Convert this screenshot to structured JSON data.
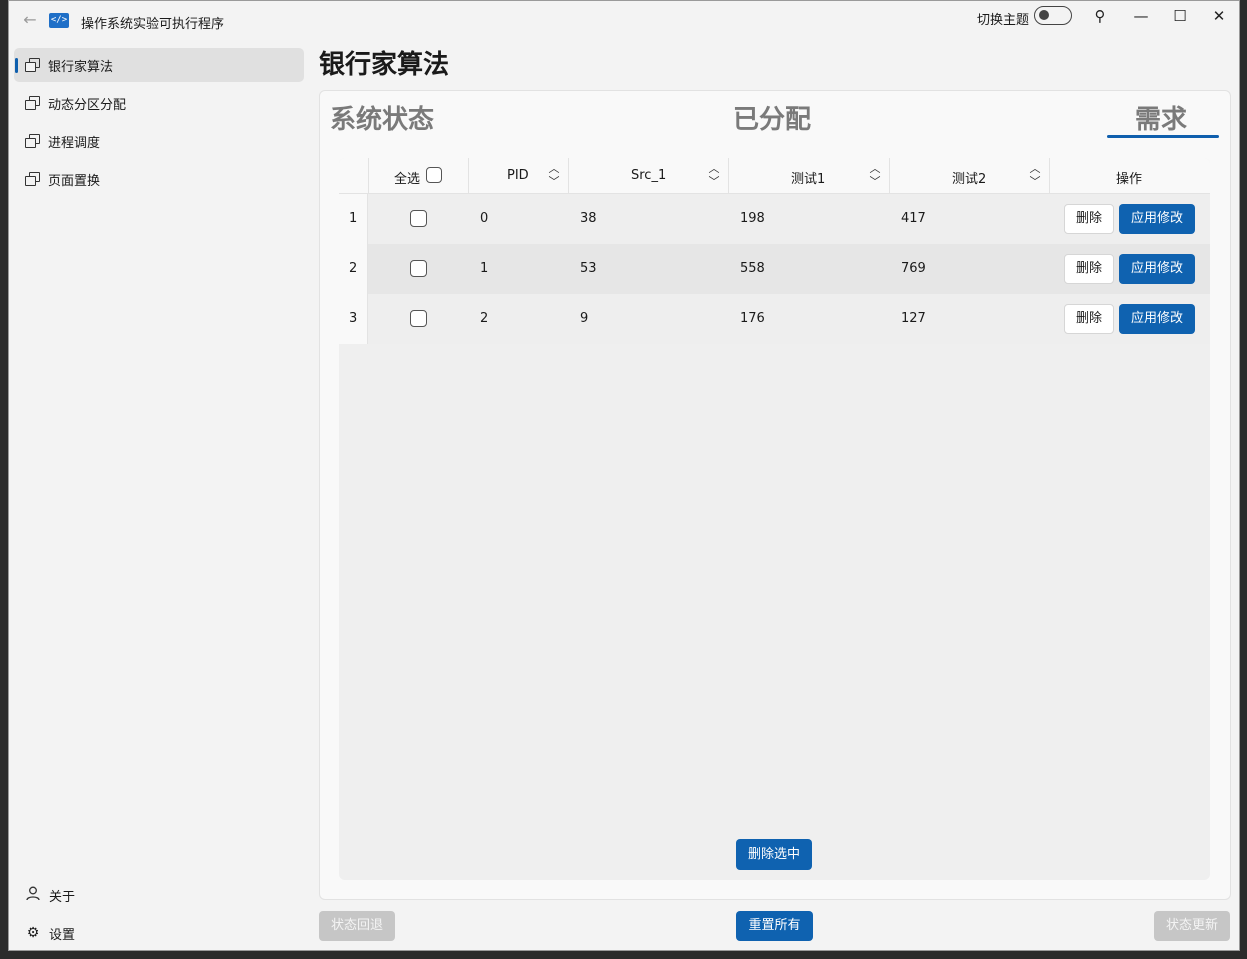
{
  "window": {
    "title": "操作系统实验可执行程序",
    "app_icon": "</>",
    "theme_toggle_label": "切换主题",
    "theme_toggle_on": false,
    "controls": {
      "pin": "⚲",
      "minimize": "—",
      "maximize": "☐",
      "close": "✕"
    }
  },
  "nav": {
    "items": [
      {
        "label": "银行家算法",
        "active": true
      },
      {
        "label": "动态分区分配",
        "active": false
      },
      {
        "label": "进程调度",
        "active": false
      },
      {
        "label": "页面置换",
        "active": false
      }
    ],
    "about": "关于",
    "settings": "设置"
  },
  "page": {
    "title": "银行家算法",
    "tabs": [
      {
        "label": "系统状态",
        "selected": false
      },
      {
        "label": "已分配",
        "selected": false
      },
      {
        "label": "需求",
        "selected": true
      }
    ]
  },
  "table": {
    "headers": {
      "select_all": "全选",
      "pid": "PID",
      "src1": "Src_1",
      "test1": "测试1",
      "test2": "测试2",
      "actions": "操作"
    },
    "rows": [
      {
        "num": "1",
        "pid": "0",
        "src1": "38",
        "test1": "198",
        "test2": "417"
      },
      {
        "num": "2",
        "pid": "1",
        "src1": "53",
        "test1": "558",
        "test2": "769"
      },
      {
        "num": "3",
        "pid": "2",
        "src1": "9",
        "test1": "176",
        "test2": "127"
      }
    ],
    "delete_label": "删除",
    "apply_label": "应用修改",
    "delete_selected": "删除选中"
  },
  "footer": {
    "rollback": "状态回退",
    "reset_all": "重置所有",
    "update": "状态更新"
  },
  "colors": {
    "accent": "#0f62b0",
    "window_bg": "#f3f3f3",
    "disabled": "#c6c6c6"
  }
}
